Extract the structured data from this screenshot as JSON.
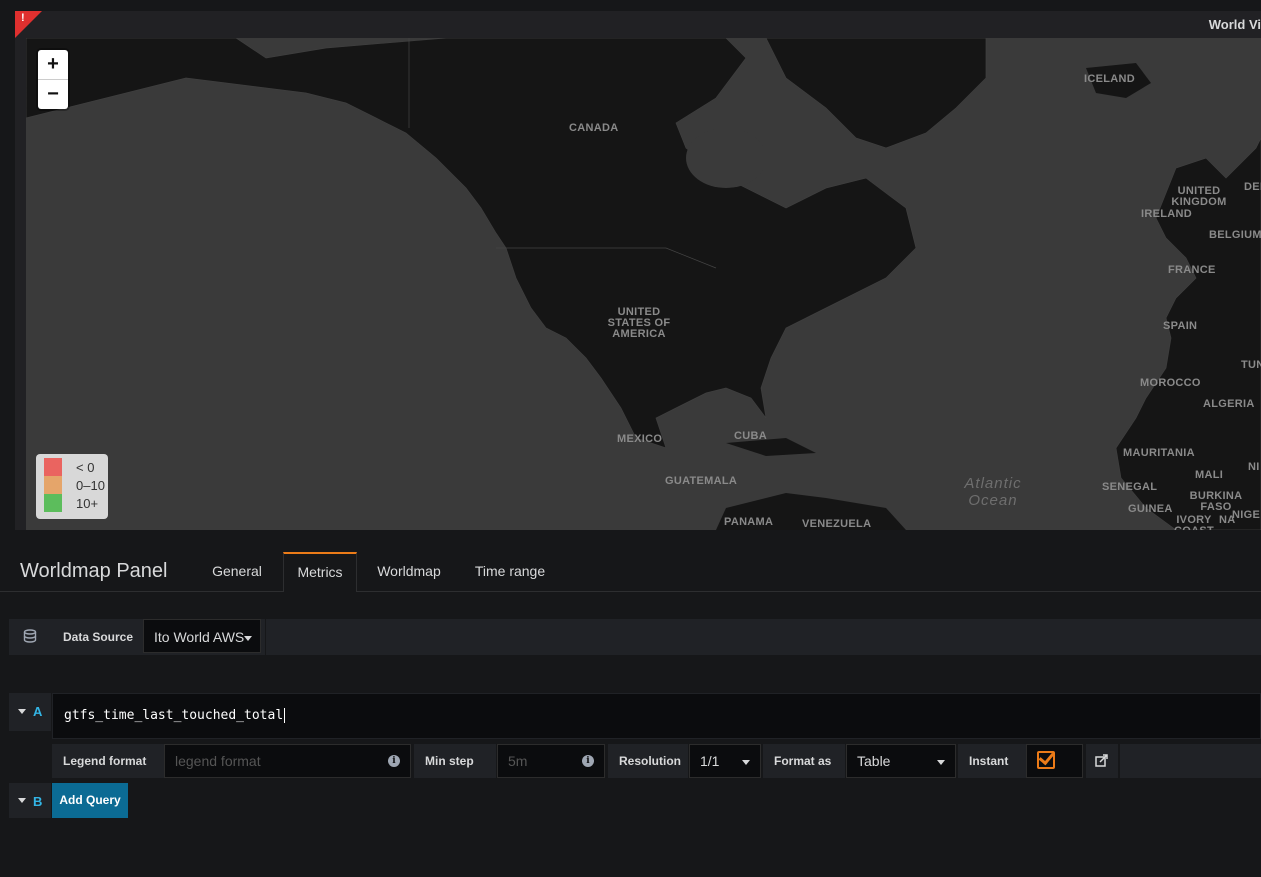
{
  "panel": {
    "title": "World Vi",
    "error_indicator": "!"
  },
  "map": {
    "zoom_in": "+",
    "zoom_out": "−",
    "labels": {
      "iceland": "ICELAND",
      "canada": "CANADA",
      "united_kingdom": "UNITED KINGDOM",
      "ireland": "IRELAND",
      "den": "DEN",
      "belgium": "BELGIUM",
      "france": "FRANCE",
      "usa": "UNITED STATES OF AMERICA",
      "spain": "SPAIN",
      "tun": "TUN",
      "morocco": "MOROCCO",
      "algeria": "ALGERIA",
      "mexico": "MEXICO",
      "cuba": "CUBA",
      "mauritania": "MAURITANIA",
      "ni": "NI",
      "mali": "MALI",
      "atlantic_ocean": "Atlantic Ocean",
      "guatemala": "GUATEMALA",
      "senegal": "SENEGAL",
      "burkina_faso": "BURKINA FASO",
      "guinea": "GUINEA",
      "nige": "NIGE",
      "ivory_coast": "IVORY COAST",
      "na": "NA",
      "panama": "PANAMA",
      "venezuela": "VENEZUELA"
    },
    "legend": [
      {
        "label": "< 0",
        "color": "#ea6460"
      },
      {
        "label": "0–10",
        "color": "#e5a56a"
      },
      {
        "label": "10+",
        "color": "#5cbd5c"
      }
    ]
  },
  "editor": {
    "title": "Worldmap Panel",
    "tabs": [
      "General",
      "Metrics",
      "Worldmap",
      "Time range"
    ],
    "active_tab": "Metrics",
    "accent_color": "#eb7b18"
  },
  "datasource": {
    "label": "Data Source",
    "value": "Ito World AWS"
  },
  "queries": {
    "a": {
      "letter": "A",
      "expression": "gtfs_time_last_touched_total",
      "legend_format_label": "Legend format",
      "legend_format_placeholder": "legend format",
      "min_step_label": "Min step",
      "min_step_placeholder": "5m",
      "resolution_label": "Resolution",
      "resolution_value": "1/1",
      "format_as_label": "Format as",
      "format_as_value": "Table",
      "instant_label": "Instant",
      "instant_checked": true
    },
    "b": {
      "letter": "B",
      "add_label": "Add Query"
    }
  }
}
